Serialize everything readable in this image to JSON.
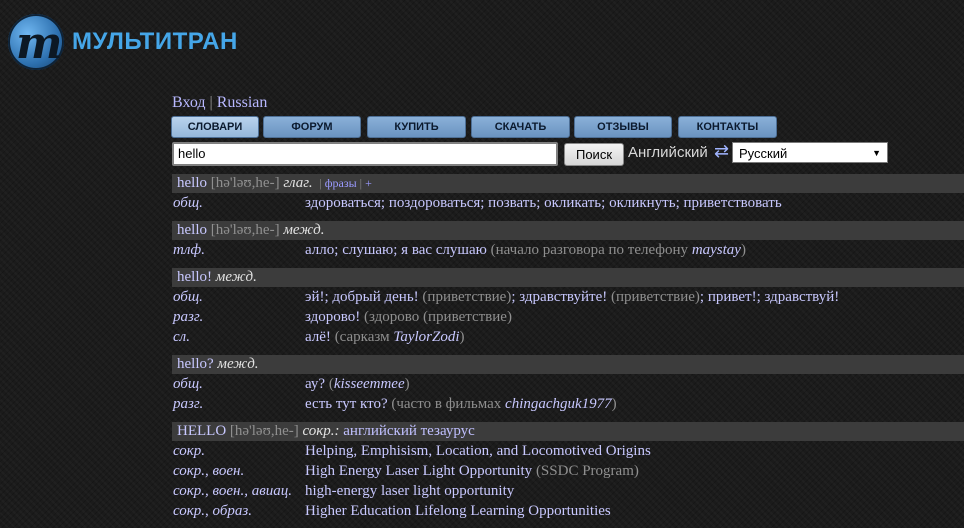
{
  "brand": {
    "logo_letter": "m",
    "name": "МУЛЬТИТРАН",
    "accent": "#45a6e8"
  },
  "top": {
    "login": "Вход",
    "sep": "|",
    "language": "Russian"
  },
  "nav": [
    {
      "label": "СЛОВАРИ",
      "active": true
    },
    {
      "label": "ФОРУМ",
      "active": false
    },
    {
      "label": "КУПИТЬ",
      "active": false
    },
    {
      "label": "СКАЧАТЬ",
      "active": false
    },
    {
      "label": "ОТЗЫВЫ",
      "active": false
    },
    {
      "label": "КОНТАКТЫ",
      "active": false
    }
  ],
  "search": {
    "value": "hello",
    "button": "Поиск",
    "from_lang": "Английский",
    "swap": "⇄",
    "to_lang": "Русский",
    "arrow": "▼"
  },
  "blocks": [
    {
      "term": "hello",
      "transcription": "[hə'ləʊ,he-]",
      "pos": "глаг.",
      "extra": {
        "sep1": "|",
        "phrases": "фразы",
        "sep2": "|",
        "plus": "+"
      },
      "rows": [
        {
          "subject": "общ.",
          "parts": [
            {
              "k": "w",
              "t": "здороваться"
            },
            {
              "k": "p",
              "t": "; "
            },
            {
              "k": "w",
              "t": "поздороваться"
            },
            {
              "k": "p",
              "t": "; "
            },
            {
              "k": "w",
              "t": "позвать"
            },
            {
              "k": "p",
              "t": "; "
            },
            {
              "k": "w",
              "t": "окликать"
            },
            {
              "k": "p",
              "t": "; "
            },
            {
              "k": "w",
              "t": "окликнуть"
            },
            {
              "k": "p",
              "t": "; "
            },
            {
              "k": "w",
              "t": "приветствовать"
            }
          ]
        }
      ]
    },
    {
      "term": "hello",
      "transcription": "[hə'ləʊ,he-]",
      "pos": "межд.",
      "rows": [
        {
          "subject": "тлф.",
          "parts": [
            {
              "k": "w",
              "t": "алло"
            },
            {
              "k": "p",
              "t": "; "
            },
            {
              "k": "w",
              "t": "слушаю"
            },
            {
              "k": "p",
              "t": "; "
            },
            {
              "k": "w",
              "t": "я вас слушаю"
            },
            {
              "k": "p",
              "t": " "
            },
            {
              "k": "c",
              "t": "(начало разговора по телефону "
            },
            {
              "k": "u",
              "t": "maystay"
            },
            {
              "k": "c",
              "t": ")"
            }
          ]
        }
      ]
    },
    {
      "term": "hello!",
      "pos": "межд.",
      "rows": [
        {
          "subject": "общ.",
          "parts": [
            {
              "k": "w",
              "t": "эй!"
            },
            {
              "k": "p",
              "t": "; "
            },
            {
              "k": "w",
              "t": "добрый день!"
            },
            {
              "k": "p",
              "t": " "
            },
            {
              "k": "c",
              "t": "(приветствие)"
            },
            {
              "k": "p",
              "t": "; "
            },
            {
              "k": "w",
              "t": "здравствуйте!"
            },
            {
              "k": "p",
              "t": " "
            },
            {
              "k": "c",
              "t": "(приветствие)"
            },
            {
              "k": "p",
              "t": "; "
            },
            {
              "k": "w",
              "t": "привет!"
            },
            {
              "k": "p",
              "t": "; "
            },
            {
              "k": "w",
              "t": "здравствуй!"
            }
          ]
        },
        {
          "subject": "разг.",
          "parts": [
            {
              "k": "w",
              "t": "здорово!"
            },
            {
              "k": "p",
              "t": " "
            },
            {
              "k": "c",
              "t": "(здорово (приветствие)"
            }
          ]
        },
        {
          "subject": "сл.",
          "parts": [
            {
              "k": "w",
              "t": "алё!"
            },
            {
              "k": "p",
              "t": " "
            },
            {
              "k": "c",
              "t": "(сарказм "
            },
            {
              "k": "u",
              "t": "TaylorZodi"
            },
            {
              "k": "c",
              "t": ")"
            }
          ]
        }
      ]
    },
    {
      "term": "hello?",
      "pos": "межд.",
      "rows": [
        {
          "subject": "общ.",
          "parts": [
            {
              "k": "w",
              "t": "ау?"
            },
            {
              "k": "p",
              "t": " "
            },
            {
              "k": "c",
              "t": "("
            },
            {
              "k": "u",
              "t": "kisseemmee"
            },
            {
              "k": "c",
              "t": ")"
            }
          ]
        },
        {
          "subject": "разг.",
          "parts": [
            {
              "k": "w",
              "t": "есть тут кто?"
            },
            {
              "k": "p",
              "t": " "
            },
            {
              "k": "c",
              "t": "(часто в фильмах "
            },
            {
              "k": "u",
              "t": "chingachguk1977"
            },
            {
              "k": "c",
              "t": ")"
            }
          ]
        }
      ]
    },
    {
      "term": "HELLO",
      "transcription": "[hə'ləʊ,he-]",
      "pos": "сокр.:",
      "link": "английский тезаурус",
      "rows": [
        {
          "subject": "сокр.",
          "parts": [
            {
              "k": "w",
              "t": "Helping, Emphisism, Location, and Locomotived Origins"
            }
          ]
        },
        {
          "subject": "сокр., воен.",
          "parts": [
            {
              "k": "w",
              "t": "High Energy Laser Light Opportunity"
            },
            {
              "k": "p",
              "t": " "
            },
            {
              "k": "c",
              "t": "(SSDC Program)"
            }
          ]
        },
        {
          "subject": "сокр., воен., авиац.",
          "parts": [
            {
              "k": "w",
              "t": "high-energy laser light opportunity"
            }
          ]
        },
        {
          "subject": "сокр., образ.",
          "parts": [
            {
              "k": "w",
              "t": "Higher Education Lifelong Learning Opportunities"
            }
          ]
        }
      ]
    }
  ]
}
